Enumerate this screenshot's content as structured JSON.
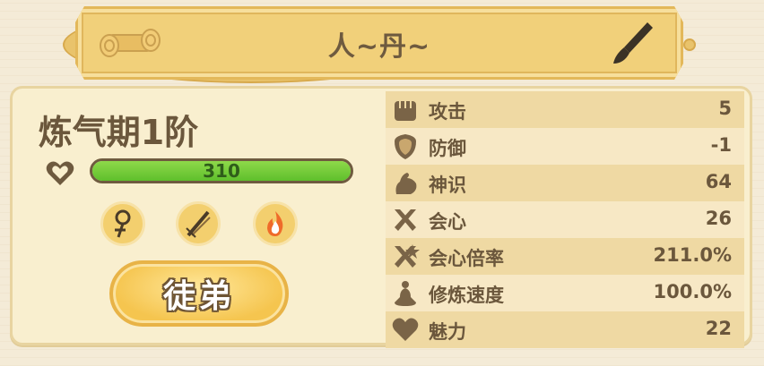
{
  "header": {
    "title": "人~丹~",
    "left_icon": "scroll-icon",
    "right_icon": "brush-icon"
  },
  "character": {
    "realm": "炼气期1阶",
    "hp": {
      "value": "310",
      "fill_fraction": 1.0,
      "icon": "heart-icon"
    },
    "skills": [
      {
        "icon": "staff-icon"
      },
      {
        "icon": "sword-icon"
      },
      {
        "icon": "fire-icon"
      }
    ],
    "disciple_button": "徒弟"
  },
  "stats": [
    {
      "icon": "fist-icon",
      "name": "攻击",
      "value": "5"
    },
    {
      "icon": "shield-icon",
      "name": "防御",
      "value": "-1"
    },
    {
      "icon": "flexed-arm-icon",
      "name": "神识",
      "value": "64"
    },
    {
      "icon": "crossed-swords-icon",
      "name": "会心",
      "value": "26"
    },
    {
      "icon": "critical-burst-icon",
      "name": "会心倍率",
      "value": "211.0%"
    },
    {
      "icon": "meditation-icon",
      "name": "修炼速度",
      "value": "100.0%"
    },
    {
      "icon": "heart-icon",
      "name": "魅力",
      "value": "22"
    }
  ],
  "colors": {
    "text_brown": "#6b573c",
    "hp_green": "#6fcb35",
    "gold": "#f3cf6e",
    "row_dark": "#efd9a3",
    "row_light": "#f7e8c5"
  }
}
